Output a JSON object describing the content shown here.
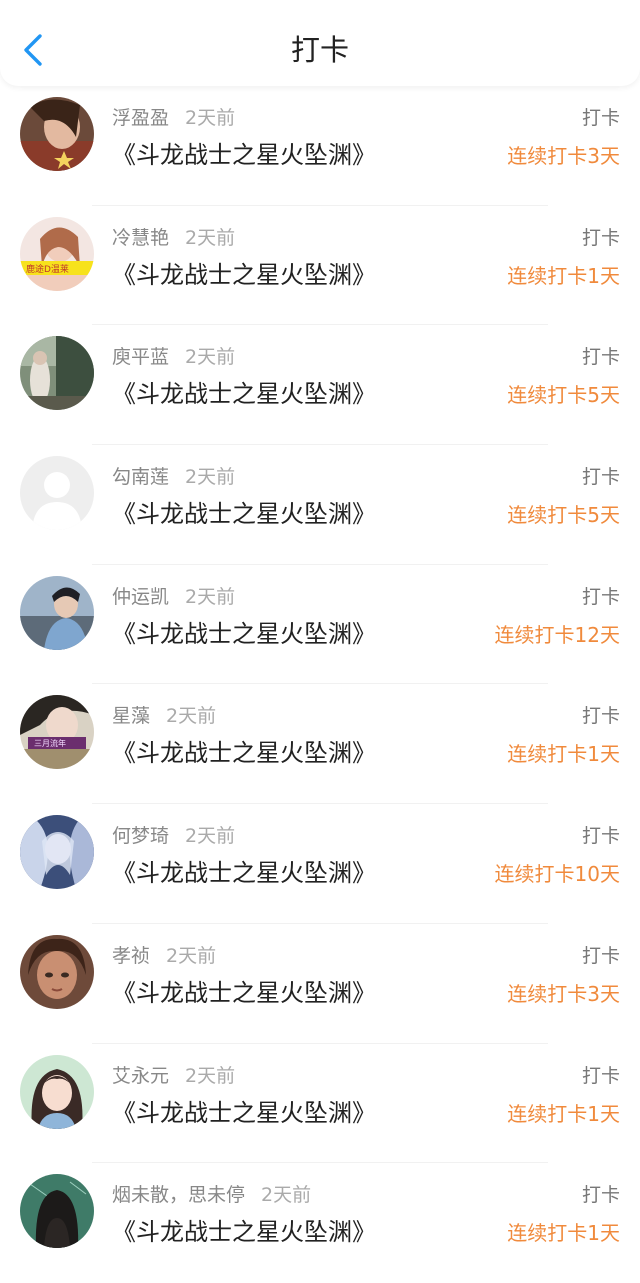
{
  "header": {
    "title": "打卡",
    "back_icon": "chevron-left-icon",
    "accent_color": "#2196f3"
  },
  "colors": {
    "streak": "#f08a3c",
    "name": "#888888",
    "time": "#aaaaaa",
    "book": "#222222"
  },
  "entries": [
    {
      "user": "浮盈盈",
      "time": "2天前",
      "book": "《斗龙战士之星火坠渊》",
      "action": "打卡",
      "streak": "连续打卡3天",
      "avatar": "photo-avatar-1"
    },
    {
      "user": "冷慧艳",
      "time": "2天前",
      "book": "《斗龙战士之星火坠渊》",
      "action": "打卡",
      "streak": "连续打卡1天",
      "avatar": "photo-avatar-2"
    },
    {
      "user": "庾平蓝",
      "time": "2天前",
      "book": "《斗龙战士之星火坠渊》",
      "action": "打卡",
      "streak": "连续打卡5天",
      "avatar": "photo-avatar-3"
    },
    {
      "user": "勾南莲",
      "time": "2天前",
      "book": "《斗龙战士之星火坠渊》",
      "action": "打卡",
      "streak": "连续打卡5天",
      "avatar": "default-avatar"
    },
    {
      "user": "仲运凯",
      "time": "2天前",
      "book": "《斗龙战士之星火坠渊》",
      "action": "打卡",
      "streak": "连续打卡12天",
      "avatar": "photo-avatar-5"
    },
    {
      "user": "星藻",
      "time": "2天前",
      "book": "《斗龙战士之星火坠渊》",
      "action": "打卡",
      "streak": "连续打卡1天",
      "avatar": "photo-avatar-6"
    },
    {
      "user": "何梦琦",
      "time": "2天前",
      "book": "《斗龙战士之星火坠渊》",
      "action": "打卡",
      "streak": "连续打卡10天",
      "avatar": "photo-avatar-7"
    },
    {
      "user": "孝祯",
      "time": "2天前",
      "book": "《斗龙战士之星火坠渊》",
      "action": "打卡",
      "streak": "连续打卡3天",
      "avatar": "photo-avatar-8"
    },
    {
      "user": "艾永元",
      "time": "2天前",
      "book": "《斗龙战士之星火坠渊》",
      "action": "打卡",
      "streak": "连续打卡1天",
      "avatar": "photo-avatar-9"
    },
    {
      "user": "烟未散，思未停",
      "time": "2天前",
      "book": "《斗龙战士之星火坠渊》",
      "action": "打卡",
      "streak": "连续打卡1天",
      "avatar": "photo-avatar-10"
    }
  ]
}
